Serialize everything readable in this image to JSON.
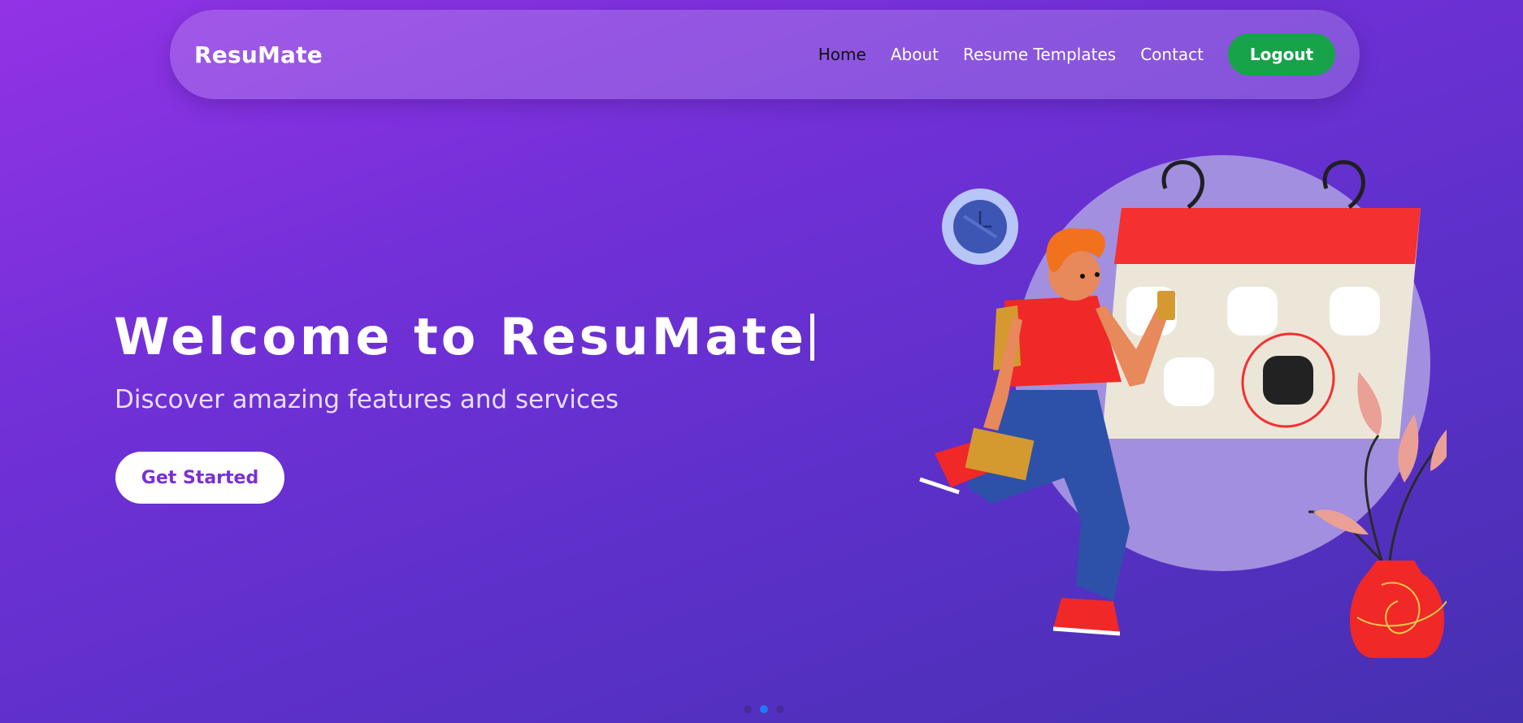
{
  "brand": "ResuMate",
  "nav": {
    "items": [
      {
        "label": "Home",
        "active": true
      },
      {
        "label": "About",
        "active": false
      },
      {
        "label": "Resume Templates",
        "active": false
      },
      {
        "label": "Contact",
        "active": false
      }
    ],
    "logout_label": "Logout"
  },
  "hero": {
    "title": "Welcome to ResuMate",
    "subtitle": "Discover amazing features and services",
    "cta_label": "Get Started"
  },
  "carousel": {
    "slide_count": 3,
    "active_index": 1
  },
  "colors": {
    "accent_green": "#16a34a",
    "cta_text": "#7a2fd6",
    "active_dot": "#1e7bf5"
  },
  "illustration_icons": [
    "calendar-icon",
    "clock-icon",
    "plant-icon",
    "person-icon"
  ]
}
